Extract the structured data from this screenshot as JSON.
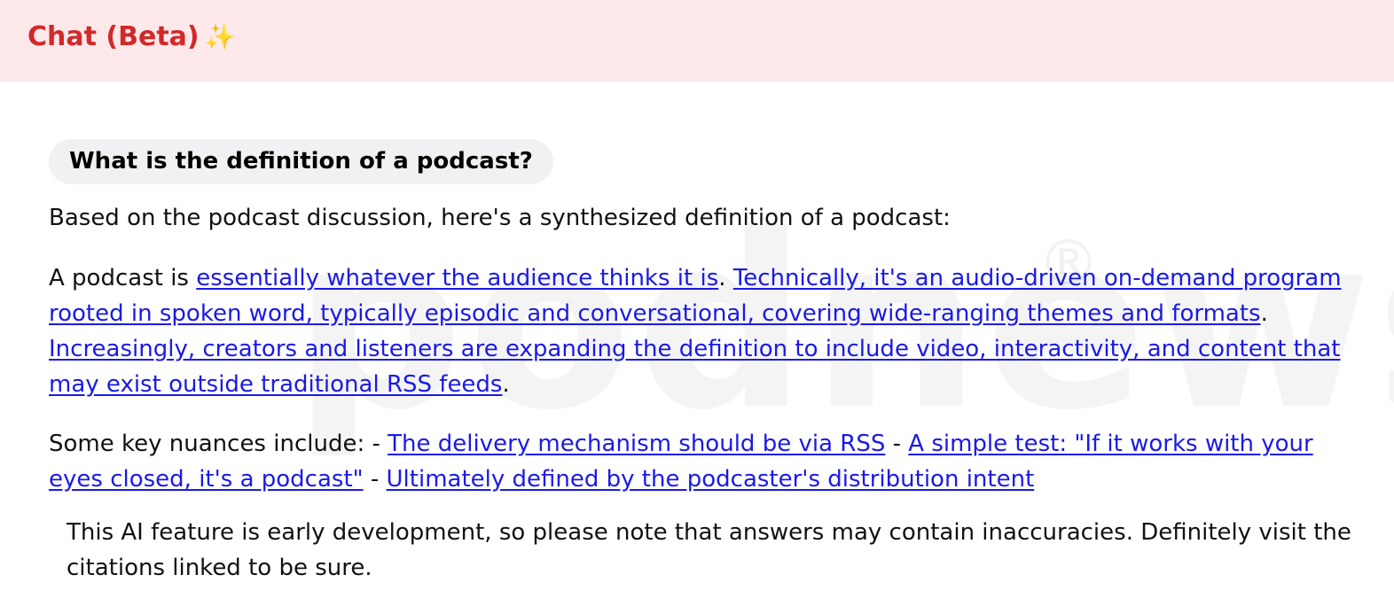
{
  "header": {
    "title": "Chat (Beta)",
    "sparkle": "✨"
  },
  "watermark": {
    "word": "podnews",
    "registered": "®"
  },
  "question": "What is the definition of a podcast?",
  "answer": {
    "intro": "Based on the podcast discussion, here's a synthesized definition of a podcast:",
    "definition_prefix": "A podcast is ",
    "citations": [
      "essentially whatever the audience thinks it is",
      "Technically, it's an audio-driven on-demand program rooted in spoken word, typically episodic and conversational, covering wide-ranging themes and formats",
      "Increasingly, creators and listeners are expanding the definition to include video, interactivity, and content that may exist outside traditional RSS feeds",
      "The delivery mechanism should be via RSS",
      "A simple test: \"If it works with your eyes closed, it's a podcast\"",
      "Ultimately defined by the podcaster's distribution intent"
    ],
    "period": ".",
    "nuances_prefix": "Some key nuances include: - ",
    "dash": " - "
  },
  "disclaimer": "This AI feature is early development, so please note that answers may contain inaccuracies. Definitely visit the citations linked to be sure.",
  "colors": {
    "header_bg": "#fde8ea",
    "title": "#d12a2a",
    "link": "#1a1ae6",
    "question_bg": "#f1f1f3"
  }
}
